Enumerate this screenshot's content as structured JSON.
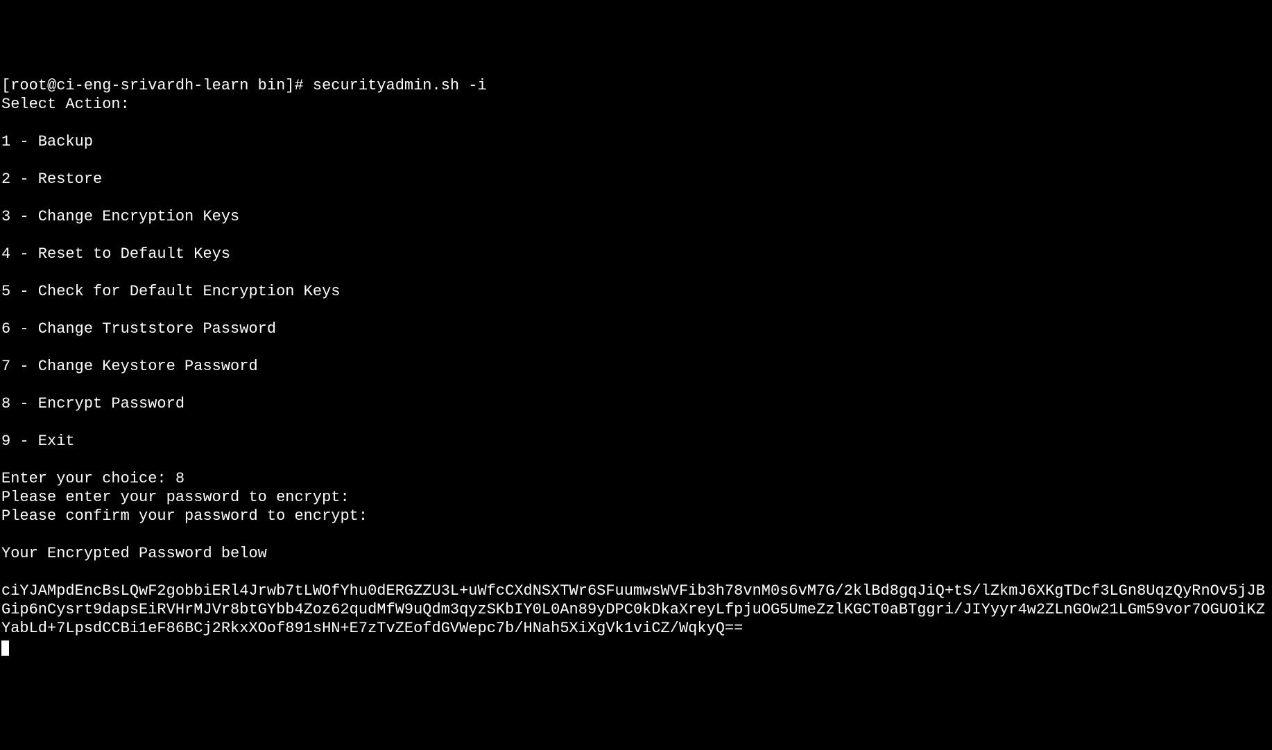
{
  "terminal": {
    "prompt": "[root@ci-eng-srivardh-learn bin]# ",
    "command": "securityadmin.sh -i",
    "select_action_header": "Select Action:",
    "menu_options": [
      "1 - Backup",
      "2 - Restore",
      "3 - Change Encryption Keys",
      "4 - Reset to Default Keys",
      "5 - Check for Default Encryption Keys",
      "6 - Change Truststore Password",
      "7 - Change Keystore Password",
      "8 - Encrypt Password",
      "9 - Exit"
    ],
    "enter_choice_prompt": "Enter your choice: ",
    "choice_value": "8",
    "password_prompt_1": "Please enter your password to encrypt:",
    "password_prompt_2": "Please confirm your password to encrypt:",
    "encrypted_header": "Your Encrypted Password below",
    "encrypted_value": "ciYJAMpdEncBsLQwF2gobbiERl4Jrwb7tLWOfYhu0dERGZZU3L+uWfcCXdNSXTWr6SFuumwsWVFib3h78vnM0s6vM7G/2klBd8gqJiQ+tS/lZkmJ6XKgTDcf3LGn8UqzQyRnOv5jJBGip6nCysrt9dapsEiRVHrMJVr8btGYbb4Zoz62qudMfW9uQdm3qyzSKbIY0L0An89yDPC0kDkaXreyLfpjuOG5UmeZzlKGCT0aBTggri/JIYyyr4w2ZLnGOw21LGm59vor7OGUOiKZYabLd+7LpsdCCBi1eF86BCj2RkxXOof891sHN+E7zTvZEofdGVWepc7b/HNah5XiXgVk1viCZ/WqkyQ=="
  }
}
